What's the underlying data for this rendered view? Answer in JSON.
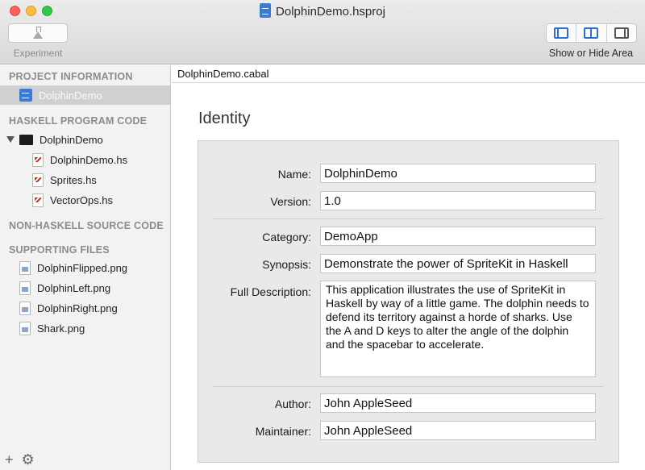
{
  "window": {
    "title": "DolphinDemo.hsproj"
  },
  "toolbar": {
    "experiment_label": "Experiment",
    "view_toggle_label": "Show or Hide Area"
  },
  "sidebar": {
    "project_header": "PROJECT INFORMATION",
    "project_item": "DolphinDemo",
    "haskell_header": "HASKELL PROGRAM CODE",
    "haskell_folder": "DolphinDemo",
    "haskell_files": [
      "DolphinDemo.hs",
      "Sprites.hs",
      "VectorOps.hs"
    ],
    "nonhaskell_header": "NON-HASKELL SOURCE CODE",
    "supporting_header": "SUPPORTING FILES",
    "supporting_files": [
      "DolphinFlipped.png",
      "DolphinLeft.png",
      "DolphinRight.png",
      "Shark.png"
    ],
    "add_button": "+",
    "settings_button": "⚙"
  },
  "editor": {
    "tab_label": "DolphinDemo.cabal",
    "section_title": "Identity",
    "fields": {
      "name_label": "Name:",
      "name_value": "DolphinDemo",
      "version_label": "Version:",
      "version_value": "1.0",
      "category_label": "Category:",
      "category_value": "DemoApp",
      "synopsis_label": "Synopsis:",
      "synopsis_value": "Demonstrate the power of SpriteKit in Haskell",
      "description_label": "Full Description:",
      "description_value": "This application illustrates the use of SpriteKit in Haskell by way of a little game. The dolphin needs to defend its territory against a horde of sharks. Use the A and D keys to alter the angle of the dolphin and the spacebar to accelerate.",
      "author_label": "Author:",
      "author_value": "John AppleSeed",
      "maintainer_label": "Maintainer:",
      "maintainer_value": "John AppleSeed"
    }
  }
}
